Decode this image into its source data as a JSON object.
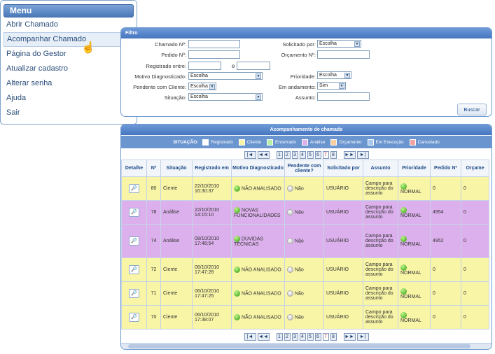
{
  "menu": {
    "title": "Menu",
    "items": [
      "Abrir Chamado",
      "Acompanhar Chamado",
      "Página do Gestor",
      "Atualizar cadastro",
      "Alterar senha",
      "Ajuda",
      "Sair"
    ]
  },
  "filter": {
    "title": "Filtro",
    "chamado_label": "Chamado Nº:",
    "pedido_label": "Pedido Nº:",
    "registrado_label": "Registrado entre:",
    "registrado_e": "e",
    "motivo_label": "Motivo Diagnosticado:",
    "motivo_value": "Escolha",
    "pendente_label": "Pendente com Cliente:",
    "pendente_value": "Escolha",
    "situacao_label": "Situação:",
    "situacao_value": "Escolha",
    "solicitado_label": "Solicitado por:",
    "solicitado_value": "Escolha",
    "orcamento_label": "Orçamento Nº:",
    "prioridade_label": "Prioridade:",
    "prioridade_value": "Escolha",
    "andamento_label": "Em andamento:",
    "andamento_value": "Sim",
    "assunto_label": "Assunto:",
    "buscar_label": "Buscar"
  },
  "grid": {
    "title": "Acompanhamento de chamado",
    "situacao_label": "SITUAÇÃO:",
    "legend": [
      {
        "label": "Registrado",
        "color": "#ffffff"
      },
      {
        "label": "Cliente",
        "color": "#f8f5a6"
      },
      {
        "label": "Encerrado",
        "color": "#b9f0a8"
      },
      {
        "label": "Análise",
        "color": "#dcb0ec"
      },
      {
        "label": "Orçamento",
        "color": "#f7cfa0"
      },
      {
        "label": "Em Execução",
        "color": "#a9c8ef"
      },
      {
        "label": "Cancelado",
        "color": "#f4a3a3"
      }
    ],
    "pager": {
      "first": "|◄",
      "prev": "◄◄",
      "pages": [
        "1",
        "2",
        "3",
        "4",
        "5",
        "6",
        "7",
        "8"
      ],
      "current": "7",
      "next": "►►",
      "last": "►|"
    },
    "columns": [
      "Detalhe",
      "Nº",
      "Situação",
      "Registrado em",
      "Motivo Diagnosticado",
      "Pendente com cliente?",
      "Solicitado por",
      "Assunto",
      "Prioridade",
      "Pedido Nº",
      "Orçame"
    ],
    "rows": [
      {
        "num": "80",
        "sit": "Ciente",
        "reg": "22/10/2010 16:30:37",
        "motivo": "NÃO ANALISADO",
        "pend": "Não",
        "solic": "USUÁRIO",
        "assunto": "Campo para descrição do assunto",
        "prio": "NORMAL",
        "pedido": "0",
        "orc": "0",
        "color": "y"
      },
      {
        "num": "78",
        "sit": "Análise",
        "reg": "22/10/2010 14:15:10",
        "motivo": "NOVAS FUNCIONALIDADES",
        "pend": "Não",
        "solic": "USUÁRIO",
        "assunto": "Campo para descrição do assunto",
        "prio": "NORMAL",
        "pedido": "4954",
        "orc": "0",
        "color": "p"
      },
      {
        "num": "74",
        "sit": "Análise",
        "reg": "08/10/2010 17:46:54",
        "motivo": "DÚVIDAS TÉCNICAS",
        "pend": "Não",
        "solic": "USUÁRIO",
        "assunto": "Campo para descrição do assunto",
        "prio": "NORMAL",
        "pedido": "4952",
        "orc": "0",
        "color": "p"
      },
      {
        "num": "72",
        "sit": "Ciente",
        "reg": "06/10/2010 17:47:28",
        "motivo": "NÃO ANALISADO",
        "pend": "Não",
        "solic": "USUÁRIO",
        "assunto": "Campo para descrição do assunto",
        "prio": "NORMAL",
        "pedido": "0",
        "orc": "0",
        "color": "y"
      },
      {
        "num": "71",
        "sit": "Ciente",
        "reg": "06/10/2010 17:47:25",
        "motivo": "NÃO ANALISADO",
        "pend": "Não",
        "solic": "USUÁRIO",
        "assunto": "Campo para descrição do assunto",
        "prio": "NORMAL",
        "pedido": "0",
        "orc": "0",
        "color": "y"
      },
      {
        "num": "70",
        "sit": "Ciente",
        "reg": "06/10/2010 17:38:07",
        "motivo": "NÃO ANALISADO",
        "pend": "Não",
        "solic": "USUÁRIO",
        "assunto": "Campo para descrição do assunto",
        "prio": "NORMAL",
        "pedido": "0",
        "orc": "0",
        "color": "y"
      }
    ]
  }
}
